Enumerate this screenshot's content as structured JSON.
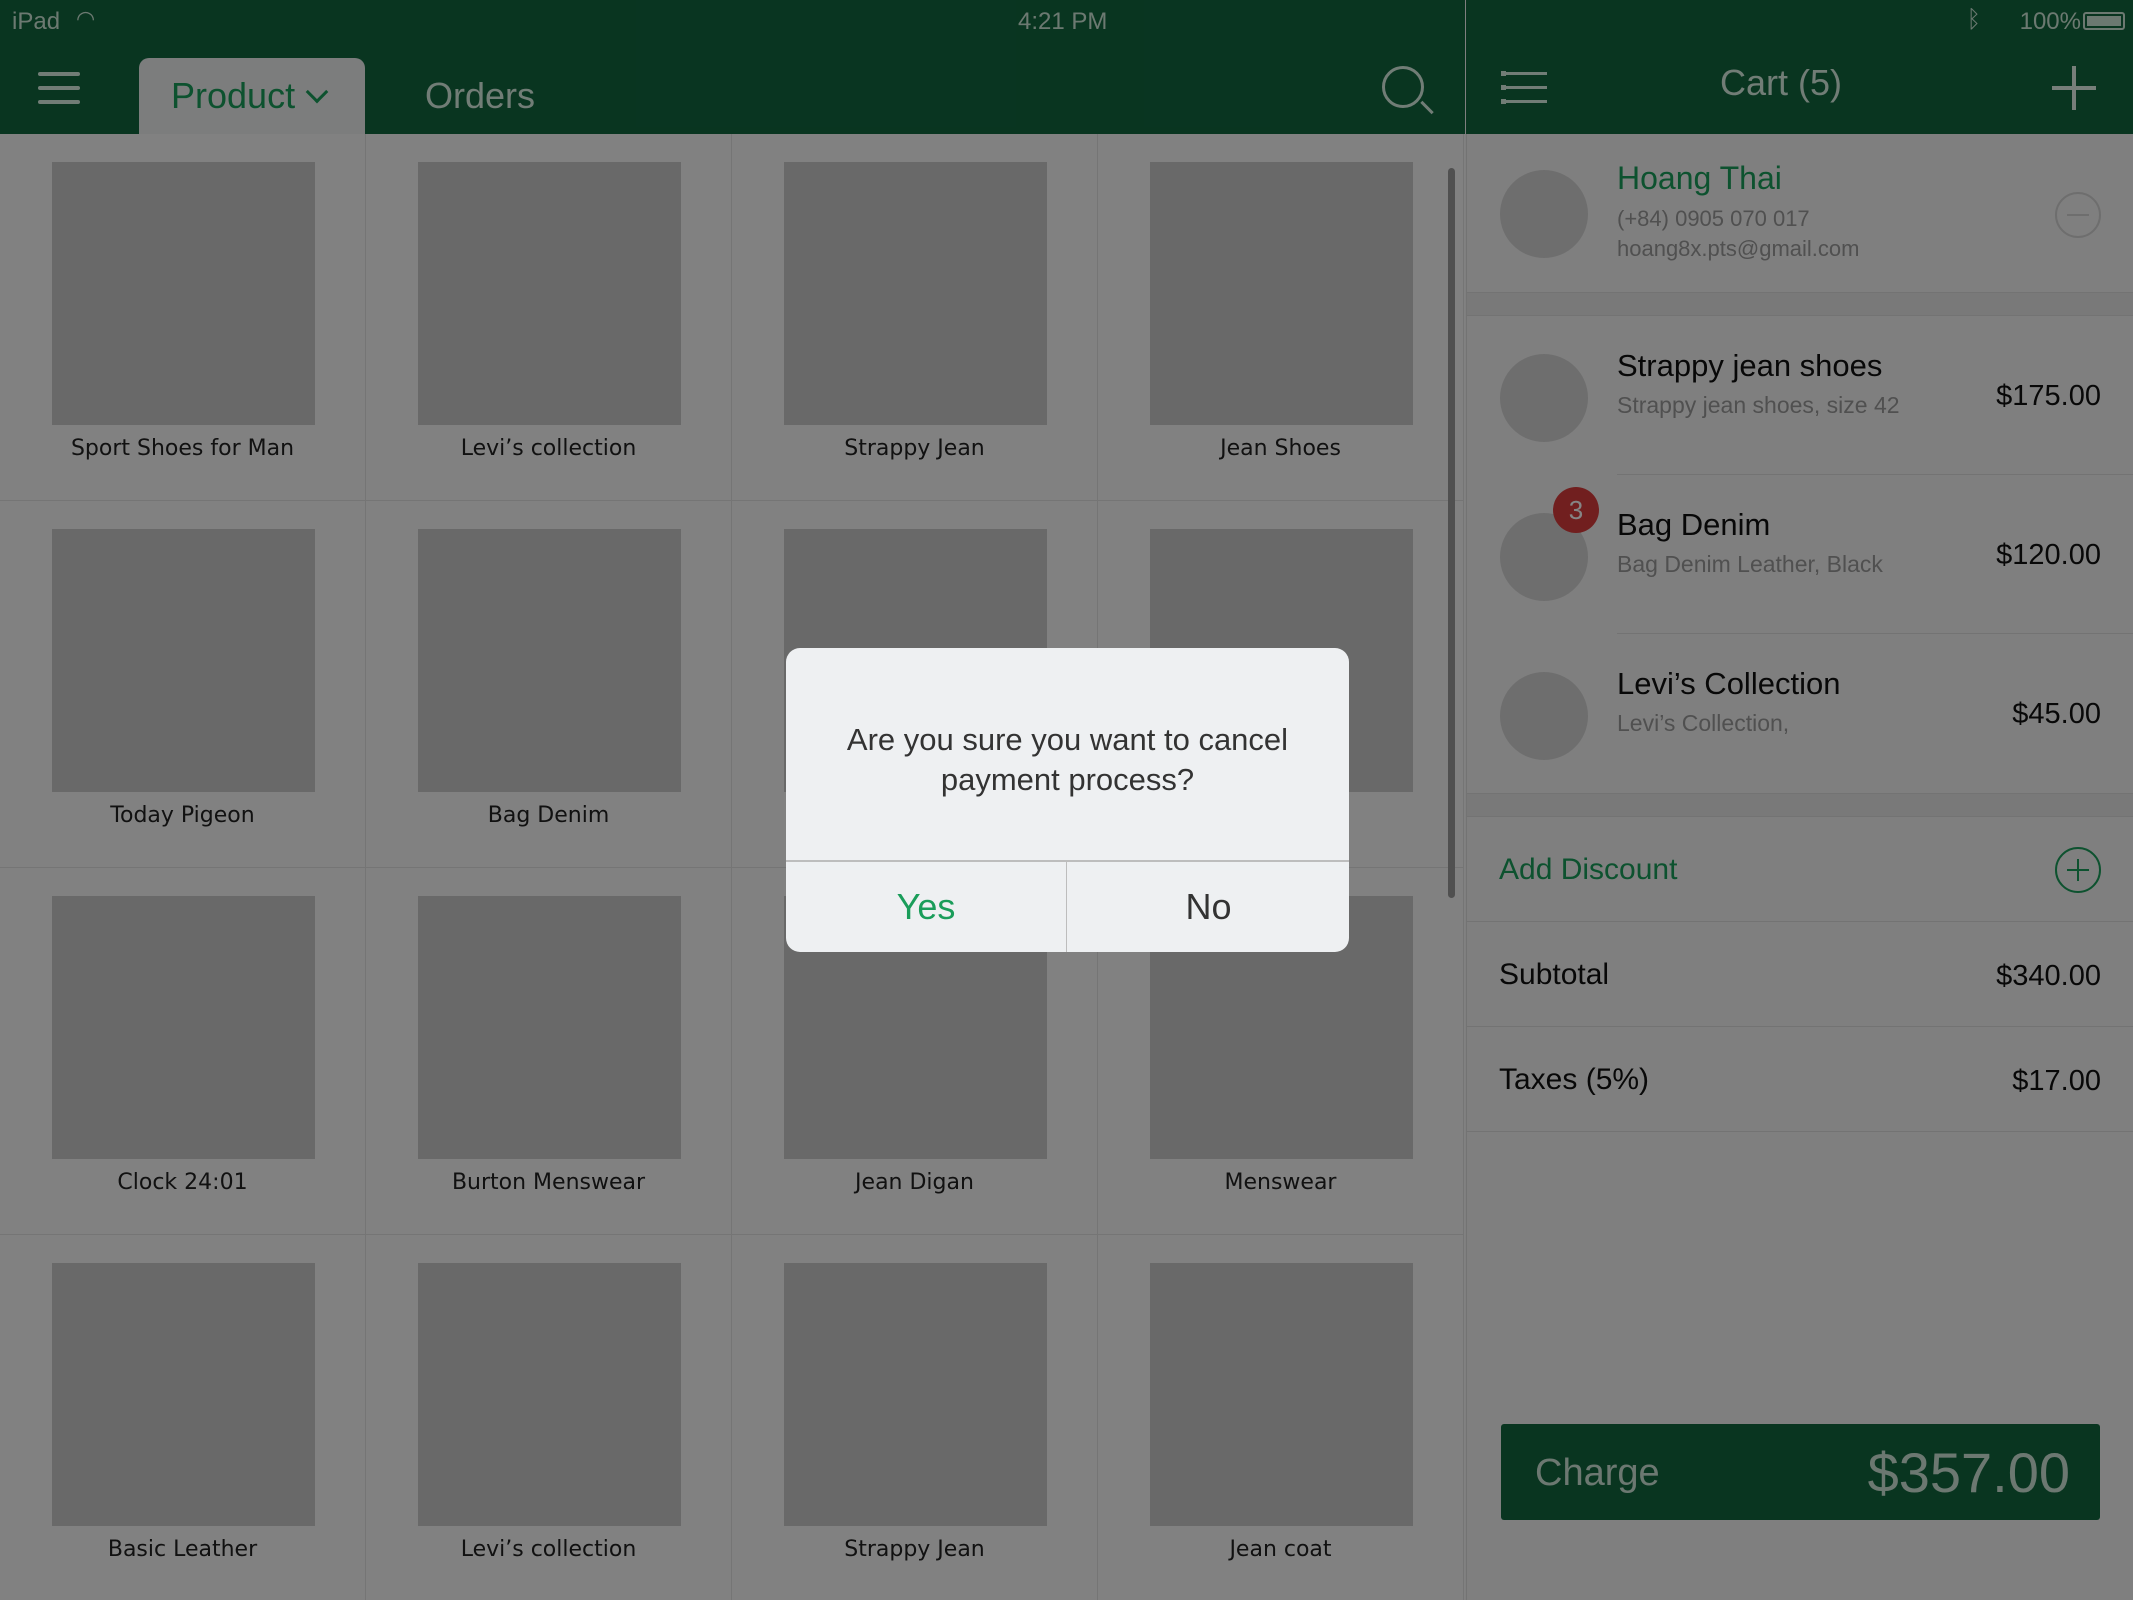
{
  "status_bar": {
    "carrier": "iPad",
    "time": "4:21 PM",
    "battery": "100%"
  },
  "header": {
    "tabs": [
      {
        "label": "Product"
      },
      {
        "label": "Orders"
      }
    ],
    "cart_title": "Cart (5)"
  },
  "products": [
    "Sport Shoes for Man",
    "Levi’s collection",
    "Strappy Jean",
    "Jean Shoes",
    "Today Pigeon",
    "Bag Denim",
    "",
    "",
    "Clock 24:01",
    "Burton Menswear",
    "Jean Digan",
    "Menswear",
    "Basic Leather",
    "Levi’s collection",
    "Strappy Jean",
    "Jean coat"
  ],
  "customer": {
    "name": "Hoang Thai",
    "phone": "(+84) 0905 070 017",
    "email": "hoang8x.pts@gmail.com"
  },
  "cart_items": [
    {
      "name": "Strappy jean shoes",
      "desc": "Strappy jean shoes, size 42",
      "price": "$175.00",
      "qty": ""
    },
    {
      "name": "Bag Denim",
      "desc": "Bag Denim Leather, Black",
      "price": "$120.00",
      "qty": "3"
    },
    {
      "name": "Levi’s Collection",
      "desc": "Levi’s Collection,",
      "price": "$45.00",
      "qty": ""
    }
  ],
  "summary": {
    "add_discount": "Add Discount",
    "subtotal_label": "Subtotal",
    "subtotal": "$340.00",
    "taxes_label": "Taxes (5%)",
    "taxes": "$17.00"
  },
  "charge": {
    "label": "Charge",
    "amount": "$357.00"
  },
  "dialog": {
    "message": "Are you sure you want to cancel payment process?",
    "yes": "Yes",
    "no": "No"
  },
  "icons": {
    "menu": "hamburger-icon",
    "search": "search-icon",
    "list": "list-icon",
    "add": "plus-icon",
    "remove_customer": "minus-circle-icon",
    "add_discount": "plus-circle-icon"
  },
  "colors": {
    "brand_green": "#12663f",
    "accent_green": "#1a9d5a",
    "badge_red": "#d93c3c"
  }
}
